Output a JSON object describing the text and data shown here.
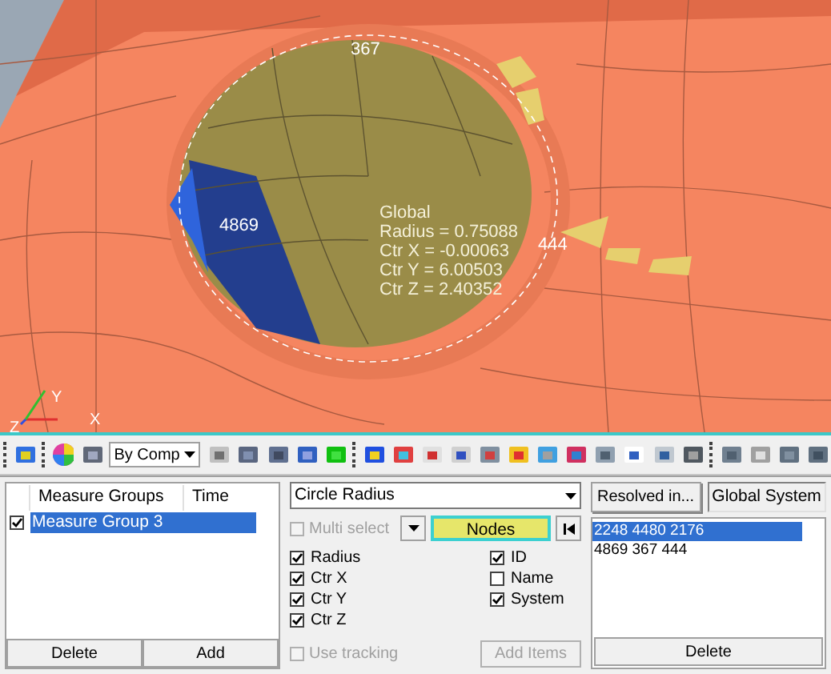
{
  "viewport": {
    "node_labels": [
      {
        "text": "367",
        "kind": "top"
      },
      {
        "text": "4869",
        "kind": "left"
      },
      {
        "text": "444",
        "kind": "right"
      }
    ],
    "annotation": [
      "Global",
      "Radius = 0.75088",
      "Ctr X = -0.00063",
      "Ctr Y = 6.00503",
      "Ctr Z = 2.40352"
    ],
    "axes": [
      "X",
      "Y",
      "Z"
    ]
  },
  "toolbar": {
    "color_mode": "By Comp"
  },
  "measure_groups": {
    "columns": [
      "Measure Groups",
      "Time"
    ],
    "rows": [
      {
        "name": "Measure Group 3",
        "checked": true,
        "selected": true
      }
    ],
    "buttons": [
      "Delete",
      "Add"
    ]
  },
  "measure": {
    "type": "Circle Radius",
    "multi_select": {
      "label": "Multi select",
      "checked": false,
      "disabled": true
    },
    "entity": "Nodes",
    "options_left": [
      {
        "label": "Radius",
        "checked": true
      },
      {
        "label": "Ctr X",
        "checked": true
      },
      {
        "label": "Ctr Y",
        "checked": true
      },
      {
        "label": "Ctr Z",
        "checked": true
      }
    ],
    "options_right": [
      {
        "label": "ID",
        "checked": true
      },
      {
        "label": "Name",
        "checked": false
      },
      {
        "label": "System",
        "checked": true
      }
    ],
    "tracking": {
      "label": "Use tracking",
      "checked": false,
      "disabled": true
    },
    "add_button": {
      "label": "Add Items",
      "disabled": true
    }
  },
  "results": {
    "resolved_button": "Resolved in...",
    "system": "Global System",
    "items": [
      {
        "text": "2248 4480 2176",
        "selected": true
      },
      {
        "text": "4869 367 444",
        "selected": false
      }
    ],
    "delete_button": "Delete"
  }
}
